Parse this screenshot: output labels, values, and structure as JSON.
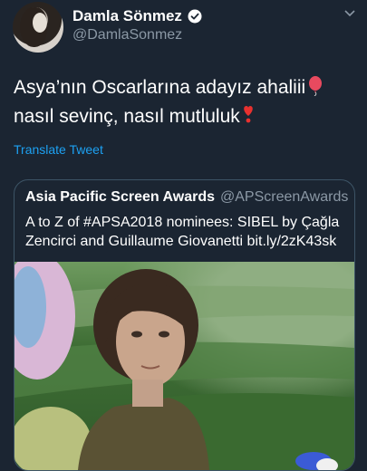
{
  "user": {
    "display_name": "Damla Sönmez",
    "handle": "@DamlaSonmez"
  },
  "tweet": {
    "line1": "Asya’nın Oscarlarına adayız ahaliii",
    "line2": "nasıl sevinç, nasıl mutluluk",
    "translate_label": "Translate Tweet"
  },
  "quoted": {
    "name": "Asia Pacific Screen Awards",
    "handle": "@APScreenAwards",
    "line1": "A to Z of #APSA2018 nominees: SIBEL by Çağla",
    "line2": "Zencirci and Guillaume Giovanetti bit.ly/2zK43sk"
  },
  "icons": {
    "verified": "verified-badge-icon",
    "menu": "chevron-down-icon",
    "emoji1": "balloon-emoji",
    "emoji2": "heart-exclamation-emoji"
  },
  "colors": {
    "background": "#1b2532",
    "link": "#1da1f2",
    "secondary": "#8b98a5",
    "border": "#3d5466"
  }
}
